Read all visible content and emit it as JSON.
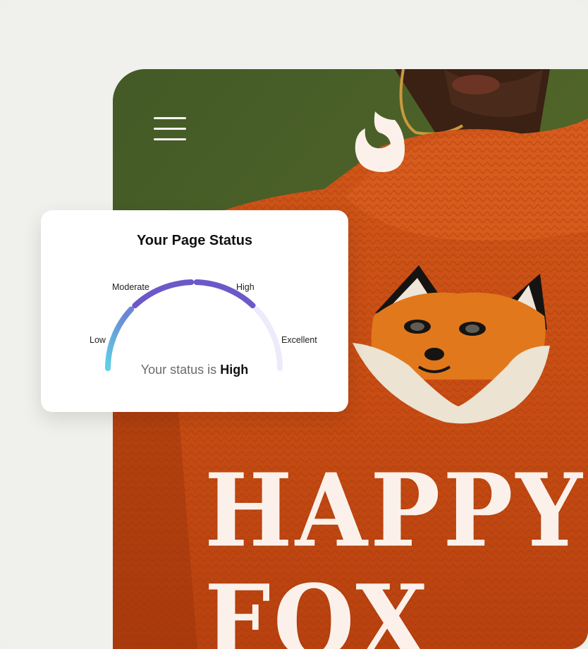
{
  "status_card": {
    "title": "Your Page Status",
    "levels": [
      "Low",
      "Moderate",
      "High",
      "Excellent"
    ],
    "current_level": "High",
    "status_prefix": "Your status is",
    "status_value": "High",
    "colors": {
      "low_start": "#5fd0e4",
      "active": "#6d58c9",
      "inactive": "#ecebfb"
    }
  },
  "app_preview": {
    "menu_icon": "hamburger-menu-icon",
    "logo_icon": "fox-flame-logo-icon",
    "headline": "HAPPY FOX"
  }
}
